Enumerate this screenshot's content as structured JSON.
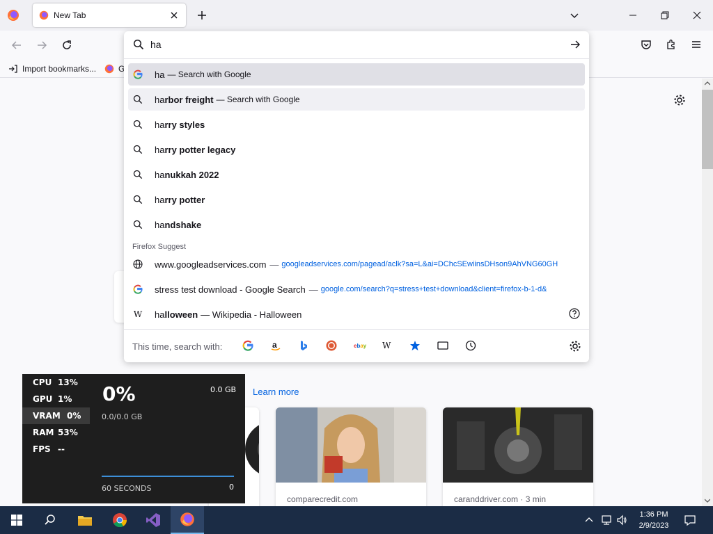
{
  "tab": {
    "title": "New Tab"
  },
  "bookmarks": {
    "import_label": "Import bookmarks...",
    "second_label": "G"
  },
  "urlbar": {
    "value": "ha",
    "rows": [
      {
        "typed": "ha",
        "rest": "",
        "action": "— Search with Google",
        "icon": "google-icon"
      },
      {
        "typed": "ha",
        "rest": "rbor freight",
        "action": "— Search with Google",
        "icon": "search-icon"
      },
      {
        "typed": "ha",
        "rest": "rry styles",
        "icon": "search-icon"
      },
      {
        "typed": "ha",
        "rest": "rry potter legacy",
        "icon": "search-icon"
      },
      {
        "typed": "ha",
        "rest": "nukkah 2022",
        "icon": "search-icon"
      },
      {
        "typed": "ha",
        "rest": "rry potter",
        "icon": "search-icon"
      },
      {
        "typed": "ha",
        "rest": "ndshake",
        "icon": "search-icon"
      }
    ],
    "suggest_header": "Firefox Suggest",
    "suggest_rows": [
      {
        "title": "www.googleadservices.com",
        "url": "googleadservices.com/pagead/aclk?sa=L&ai=DChcSEwiinsDHson9AhVNG60GH",
        "icon": "globe-icon"
      },
      {
        "title": "stress test download - Google Search",
        "url": "google.com/search?q=stress+test+download&client=firefox-b-1-d&",
        "icon": "google-icon"
      }
    ],
    "wiki_row": {
      "typed": "ha",
      "rest": "lloween",
      "suffix": "— Wikipedia - Halloween"
    },
    "footer_label": "This time, search with:",
    "engines": [
      "google-icon",
      "amazon-icon",
      "bing-icon",
      "duckduckgo-icon",
      "ebay-icon",
      "wikipedia-icon",
      "bookmarks-icon",
      "tabs-icon",
      "history-icon"
    ]
  },
  "content": {
    "learn_more": "Learn more",
    "cards": [
      {
        "source": ""
      },
      {
        "source": "comparecredit.com"
      },
      {
        "source": "caranddriver.com · 3 min"
      }
    ]
  },
  "perf": {
    "rows": [
      {
        "k": "CPU",
        "v": "13%"
      },
      {
        "k": "GPU",
        "v": "1%"
      },
      {
        "k": "VRAM",
        "v": "0%"
      },
      {
        "k": "RAM",
        "v": "53%"
      },
      {
        "k": "FPS",
        "v": "--"
      }
    ],
    "big": "0%",
    "gb": "0.0 GB",
    "sub": "0.0/0.0 GB",
    "seconds": "60 SECONDS",
    "zero": "0"
  },
  "taskbar": {
    "time": "1:36 PM",
    "date": "2/9/2023"
  },
  "colors": {
    "accent": "#0061e0",
    "taskbar": "#1b2c45"
  }
}
